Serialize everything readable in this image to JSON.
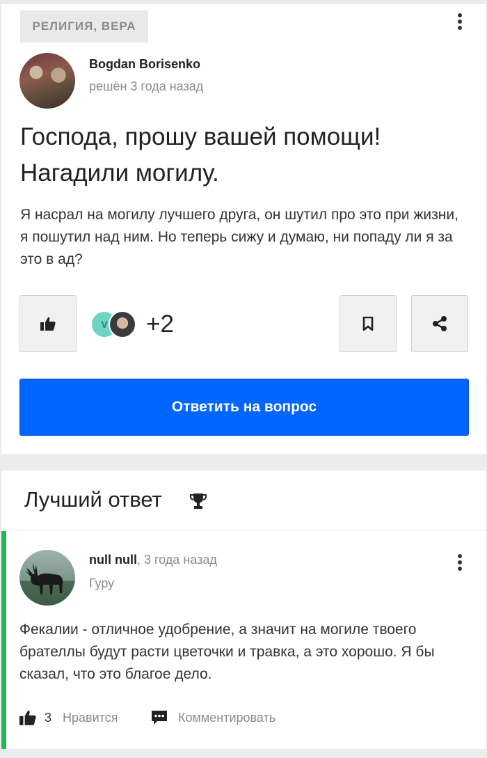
{
  "question": {
    "category": "РЕЛИГИЯ, ВЕРА",
    "author": {
      "name": "Bogdan Borisenko",
      "meta": "решён 3 года назад"
    },
    "title": "Господа, прошу вашей помощи! Нагадили могилу.",
    "body": "Я насрал на могилу лучшего друга, он шутил про это при жизни, я пошутил над ним. Но теперь сижу и думаю, ни попаду ли я за это в ад?",
    "likers": {
      "first_initial": "V",
      "extra_count": "+2"
    },
    "answer_button": "Ответить на вопрос"
  },
  "best_answer": {
    "heading": "Лучший ответ",
    "author": {
      "name": "null null",
      "time": ", 3 года назад",
      "rank": "Гуру"
    },
    "body": "Фекалии - отличное удобрение, а значит на могиле твоего брателлы будут расти цветочки и травка, а это хорошо. Я бы сказал, что это благое дело.",
    "likes": "3",
    "like_label": "Нравится",
    "comment_label": "Комментировать"
  },
  "colors": {
    "primary": "#0066ff",
    "accent_green": "#1db954",
    "muted": "#8a8a8a"
  }
}
